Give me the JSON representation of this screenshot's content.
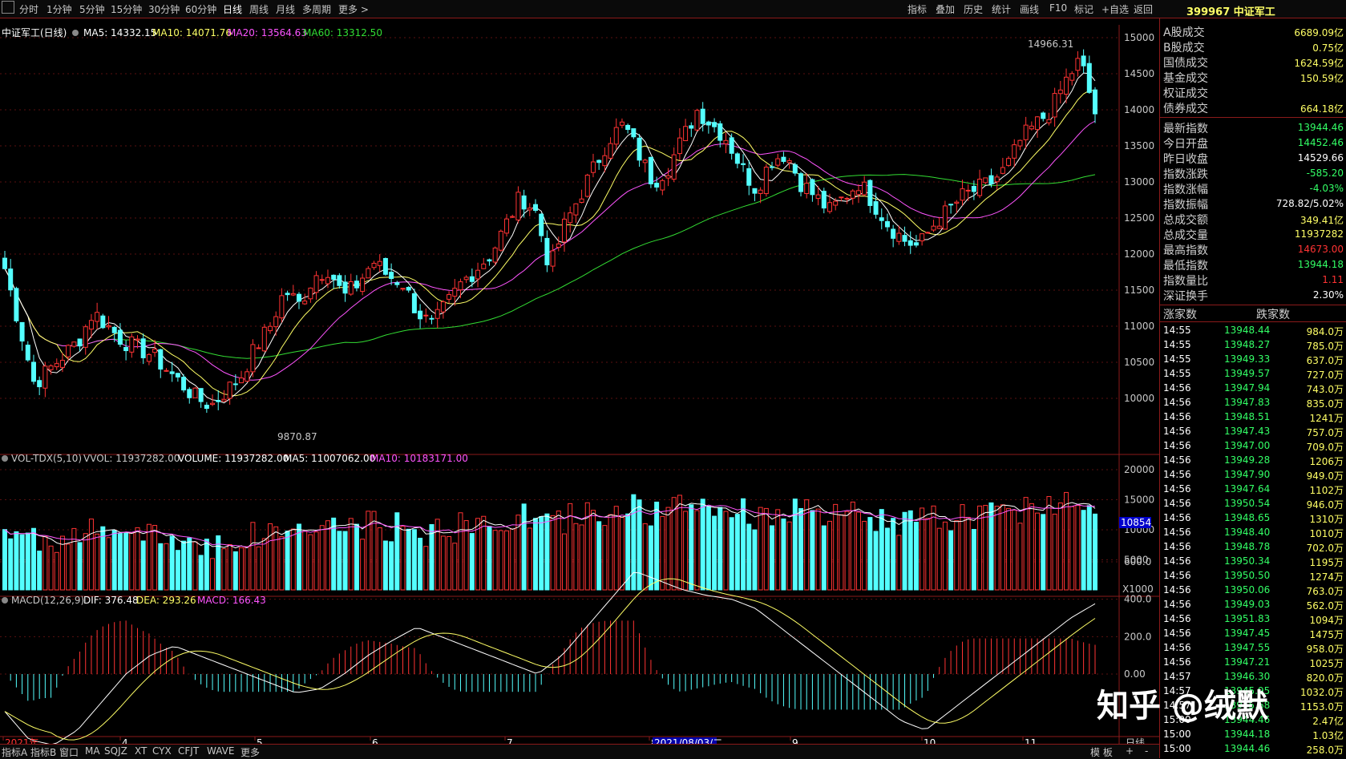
{
  "toolbar": {
    "periods": [
      "分时",
      "1分钟",
      "5分钟",
      "15分钟",
      "30分钟",
      "60分钟",
      "日线",
      "周线",
      "月线",
      "多周期",
      "更多 >"
    ],
    "active_period": "日线",
    "tools": [
      "指标",
      "叠加",
      "历史",
      "统计",
      "画线",
      "F10",
      "标记",
      "+自选",
      "返回"
    ]
  },
  "main_panel": {
    "title": "中证军工(日线)",
    "ma5": "MA5: 14332.15",
    "ma10": "MA10: 14071.76",
    "ma20": "MA20: 13564.63",
    "ma60": "MA60: 13312.50",
    "high_label": "14966.31",
    "low_label": "9870.87",
    "yticks": [
      "15000",
      "14500",
      "14000",
      "13500",
      "13000",
      "12500",
      "12000",
      "11500",
      "11000",
      "10500",
      "10000"
    ]
  },
  "vol_panel": {
    "title": "VOL-TDX(5,10)",
    "vvol": "VVOL: 11937282.00",
    "volume": "VOLUME: 11937282.00",
    "ma5": "MA5: 11007062.00",
    "ma10": "MA10: 10183171.00",
    "yticks": [
      "20000",
      "15000",
      "10000",
      "5000"
    ],
    "cursor_value": "10854",
    "unit": "X1000"
  },
  "macd_panel": {
    "title": "MACD(12,26,9)",
    "dif": "DIF: 376.48",
    "dea": "DEA: 293.26",
    "macd": "MACD: 166.43",
    "yticks": [
      "600.0",
      "400.0",
      "200.0",
      "0.00"
    ]
  },
  "date_axis": {
    "labels": [
      "2021年",
      "4",
      "5",
      "6",
      "7",
      "8",
      "9",
      "10",
      "11"
    ],
    "cursor_date": "2021/08/03/二",
    "period": "日线"
  },
  "bottom_tabs": [
    "指标A",
    "指标B",
    "窗口",
    "MA",
    "SQJZ",
    "XT",
    "CYX",
    "CFJT",
    "WAVE",
    "更多"
  ],
  "bottom_right": [
    "模 板",
    "+",
    "-"
  ],
  "right_panel": {
    "header": "399967 中证军工",
    "turnover": [
      {
        "label": "A股成交",
        "value": "6689.09亿",
        "color": "#ffff66"
      },
      {
        "label": "B股成交",
        "value": "0.75亿",
        "color": "#ffff66"
      },
      {
        "label": "国债成交",
        "value": "1624.59亿",
        "color": "#ffff66"
      },
      {
        "label": "基金成交",
        "value": "150.59亿",
        "color": "#ffff66"
      },
      {
        "label": "权证成交",
        "value": "",
        "color": "#ffff66"
      },
      {
        "label": "债券成交",
        "value": "664.18亿",
        "color": "#ffff66"
      }
    ],
    "stats": [
      {
        "label": "最新指数",
        "value": "13944.46",
        "color": "#33ff66"
      },
      {
        "label": "今日开盘",
        "value": "14452.46",
        "color": "#33ff66"
      },
      {
        "label": "昨日收盘",
        "value": "14529.66",
        "color": "#ffffff"
      },
      {
        "label": "指数涨跌",
        "value": "-585.20",
        "color": "#33ff66"
      },
      {
        "label": "指数涨幅",
        "value": "-4.03%",
        "color": "#33ff66"
      },
      {
        "label": "指数振幅",
        "value": "728.82/5.02%",
        "color": "#ffffff"
      },
      {
        "label": "总成交额",
        "value": "349.41亿",
        "color": "#ffff66"
      },
      {
        "label": "总成交量",
        "value": "11937282",
        "color": "#ffff66"
      },
      {
        "label": "最高指数",
        "value": "14673.00",
        "color": "#ff3333"
      },
      {
        "label": "最低指数",
        "value": "13944.18",
        "color": "#33ff66"
      },
      {
        "label": "指数量比",
        "value": "1.11",
        "color": "#ff3333"
      },
      {
        "label": "深证换手",
        "value": "2.30%",
        "color": "#ffffff"
      }
    ],
    "updown_headers": [
      "涨家数",
      "跌家数"
    ],
    "ticks": [
      [
        "14:55",
        "13948.44",
        "984.0万"
      ],
      [
        "14:55",
        "13948.27",
        "785.0万"
      ],
      [
        "14:55",
        "13949.33",
        "637.0万"
      ],
      [
        "14:55",
        "13949.57",
        "727.0万"
      ],
      [
        "14:56",
        "13947.94",
        "743.0万"
      ],
      [
        "14:56",
        "13947.83",
        "835.0万"
      ],
      [
        "14:56",
        "13948.51",
        "1241万"
      ],
      [
        "14:56",
        "13947.43",
        "757.0万"
      ],
      [
        "14:56",
        "13947.00",
        "709.0万"
      ],
      [
        "14:56",
        "13949.28",
        "1206万"
      ],
      [
        "14:56",
        "13947.90",
        "949.0万"
      ],
      [
        "14:56",
        "13947.64",
        "1102万"
      ],
      [
        "14:56",
        "13950.54",
        "946.0万"
      ],
      [
        "14:56",
        "13948.65",
        "1310万"
      ],
      [
        "14:56",
        "13948.40",
        "1010万"
      ],
      [
        "14:56",
        "13948.78",
        "702.0万"
      ],
      [
        "14:56",
        "13950.34",
        "1195万"
      ],
      [
        "14:56",
        "13950.50",
        "1274万"
      ],
      [
        "14:56",
        "13950.06",
        "763.0万"
      ],
      [
        "14:56",
        "13949.03",
        "562.0万"
      ],
      [
        "14:56",
        "13951.83",
        "1094万"
      ],
      [
        "14:56",
        "13947.45",
        "1475万"
      ],
      [
        "14:56",
        "13947.55",
        "958.0万"
      ],
      [
        "14:56",
        "13947.21",
        "1025万"
      ],
      [
        "14:57",
        "13946.30",
        "820.0万"
      ],
      [
        "14:57",
        "13945.95",
        "1032.0万"
      ],
      [
        "14:57",
        "13945.68",
        "1153.0万"
      ],
      [
        "15:00",
        "13944.46",
        "2.47亿"
      ],
      [
        "15:00",
        "13944.18",
        "1.03亿"
      ],
      [
        "15:00",
        "13944.46",
        "258.0万"
      ]
    ]
  },
  "watermark": "知乎 @绒默",
  "colors": {
    "up": "#ff3333",
    "down": "#54ffff",
    "ma5": "#ffffff",
    "ma10": "#ffff66",
    "ma20": "#ff55ff",
    "ma60": "#33dd33",
    "border": "#8b1a1a"
  },
  "chart_data": {
    "type": "candlestick",
    "x_ticks": [
      "2021年",
      "4",
      "5",
      "6",
      "7",
      "8",
      "9",
      "10",
      "11"
    ],
    "ylim": [
      9870.87,
      14966.31
    ],
    "close_path": [
      11800,
      11000,
      10200,
      10400,
      10600,
      10800,
      11200,
      11000,
      10800,
      10700,
      10600,
      10400,
      10200,
      10000,
      9900,
      10100,
      10300,
      10700,
      11000,
      11500,
      11300,
      11700,
      11800,
      11400,
      11600,
      11900,
      11700,
      11600,
      11200,
      11000,
      11300,
      11600,
      11800,
      12000,
      12400,
      12800,
      12600,
      11800,
      12400,
      12800,
      13200,
      13600,
      13800,
      13400,
      13000,
      13200,
      13600,
      14000,
      13800,
      13600,
      13200,
      12900,
      13300,
      13400,
      13000,
      12800,
      12600,
      12800,
      13000,
      12700,
      12400,
      12200,
      12100,
      12400,
      12600,
      12800,
      12900,
      13000,
      13200,
      13600,
      13800,
      14000,
      14400,
      14700,
      13944
    ],
    "macd_dif": [
      -200,
      -350,
      -380,
      -300,
      -150,
      0,
      100,
      150,
      100,
      50,
      0,
      -50,
      -100,
      -80,
      0,
      100,
      180,
      250,
      200,
      150,
      100,
      50,
      0,
      100,
      250,
      400,
      550,
      500,
      450,
      420,
      400,
      350,
      250,
      150,
      50,
      -50,
      -150,
      -250,
      -300,
      -200,
      -100,
      0,
      100,
      200,
      300,
      376
    ]
  }
}
